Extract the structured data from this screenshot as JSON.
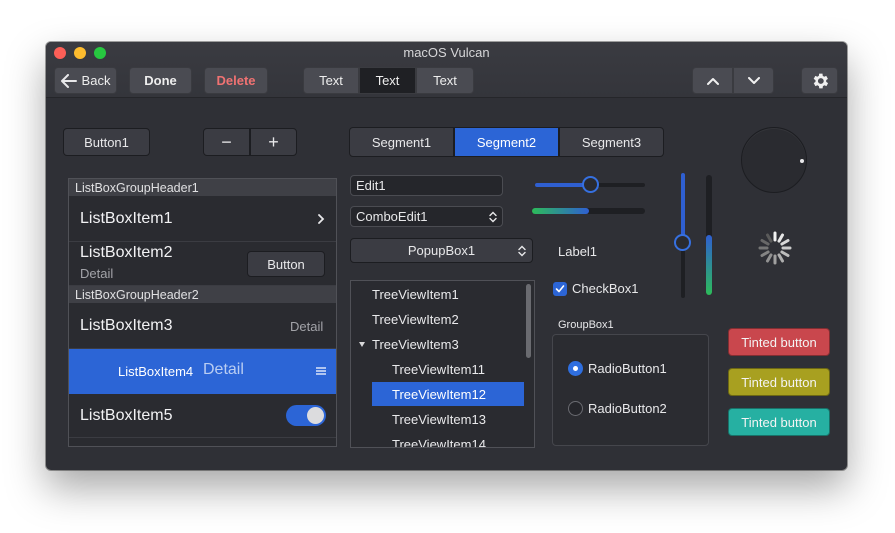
{
  "window": {
    "title": "macOS Vulcan"
  },
  "toolbar": {
    "back_label": "Back",
    "done_label": "Done",
    "delete_label": "Delete",
    "text_tabs": [
      "Text",
      "Text",
      "Text"
    ]
  },
  "controls": {
    "button1_label": "Button1",
    "minus_label": "−",
    "plus_label": "+",
    "segments": [
      "Segment1",
      "Segment2",
      "Segment3"
    ],
    "edit1_value": "Edit1",
    "comboedit1_value": "ComboEdit1",
    "popupbox1_value": "PopupBox1",
    "label1": "Label1",
    "checkbox1_label": "CheckBox1",
    "checkbox1_checked": true,
    "slider_value": 0.5,
    "progress_value": 0.5,
    "vslider_value": 0.45,
    "vprogress_value": 0.5
  },
  "listbox": {
    "header1": "ListBoxGroupHeader1",
    "header2": "ListBoxGroupHeader2",
    "items": [
      {
        "title": "ListBoxItem1"
      },
      {
        "title": "ListBoxItem2",
        "detail": "Detail",
        "button": "Button"
      },
      {
        "title": "ListBoxItem3",
        "detail": "Detail"
      },
      {
        "title": "ListBoxItem4",
        "detail": "Detail"
      },
      {
        "title": "ListBoxItem5",
        "toggle": true
      }
    ]
  },
  "tree": {
    "items": [
      "TreeViewItem1",
      "TreeViewItem2",
      "TreeViewItem3",
      "TreeViewItem11",
      "TreeViewItem12",
      "TreeViewItem13",
      "TreeViewItem14"
    ]
  },
  "groupbox": {
    "title": "GroupBox1",
    "radio1": "RadioButton1",
    "radio2": "RadioButton2"
  },
  "tinted": {
    "labels": [
      "Tinted button",
      "Tinted button",
      "Tinted button"
    ],
    "colors": [
      "#c9474d",
      "#a8a020",
      "#26b0a2"
    ]
  },
  "colors": {
    "accent": "#2c65d6",
    "green": "#2dbb5a"
  }
}
